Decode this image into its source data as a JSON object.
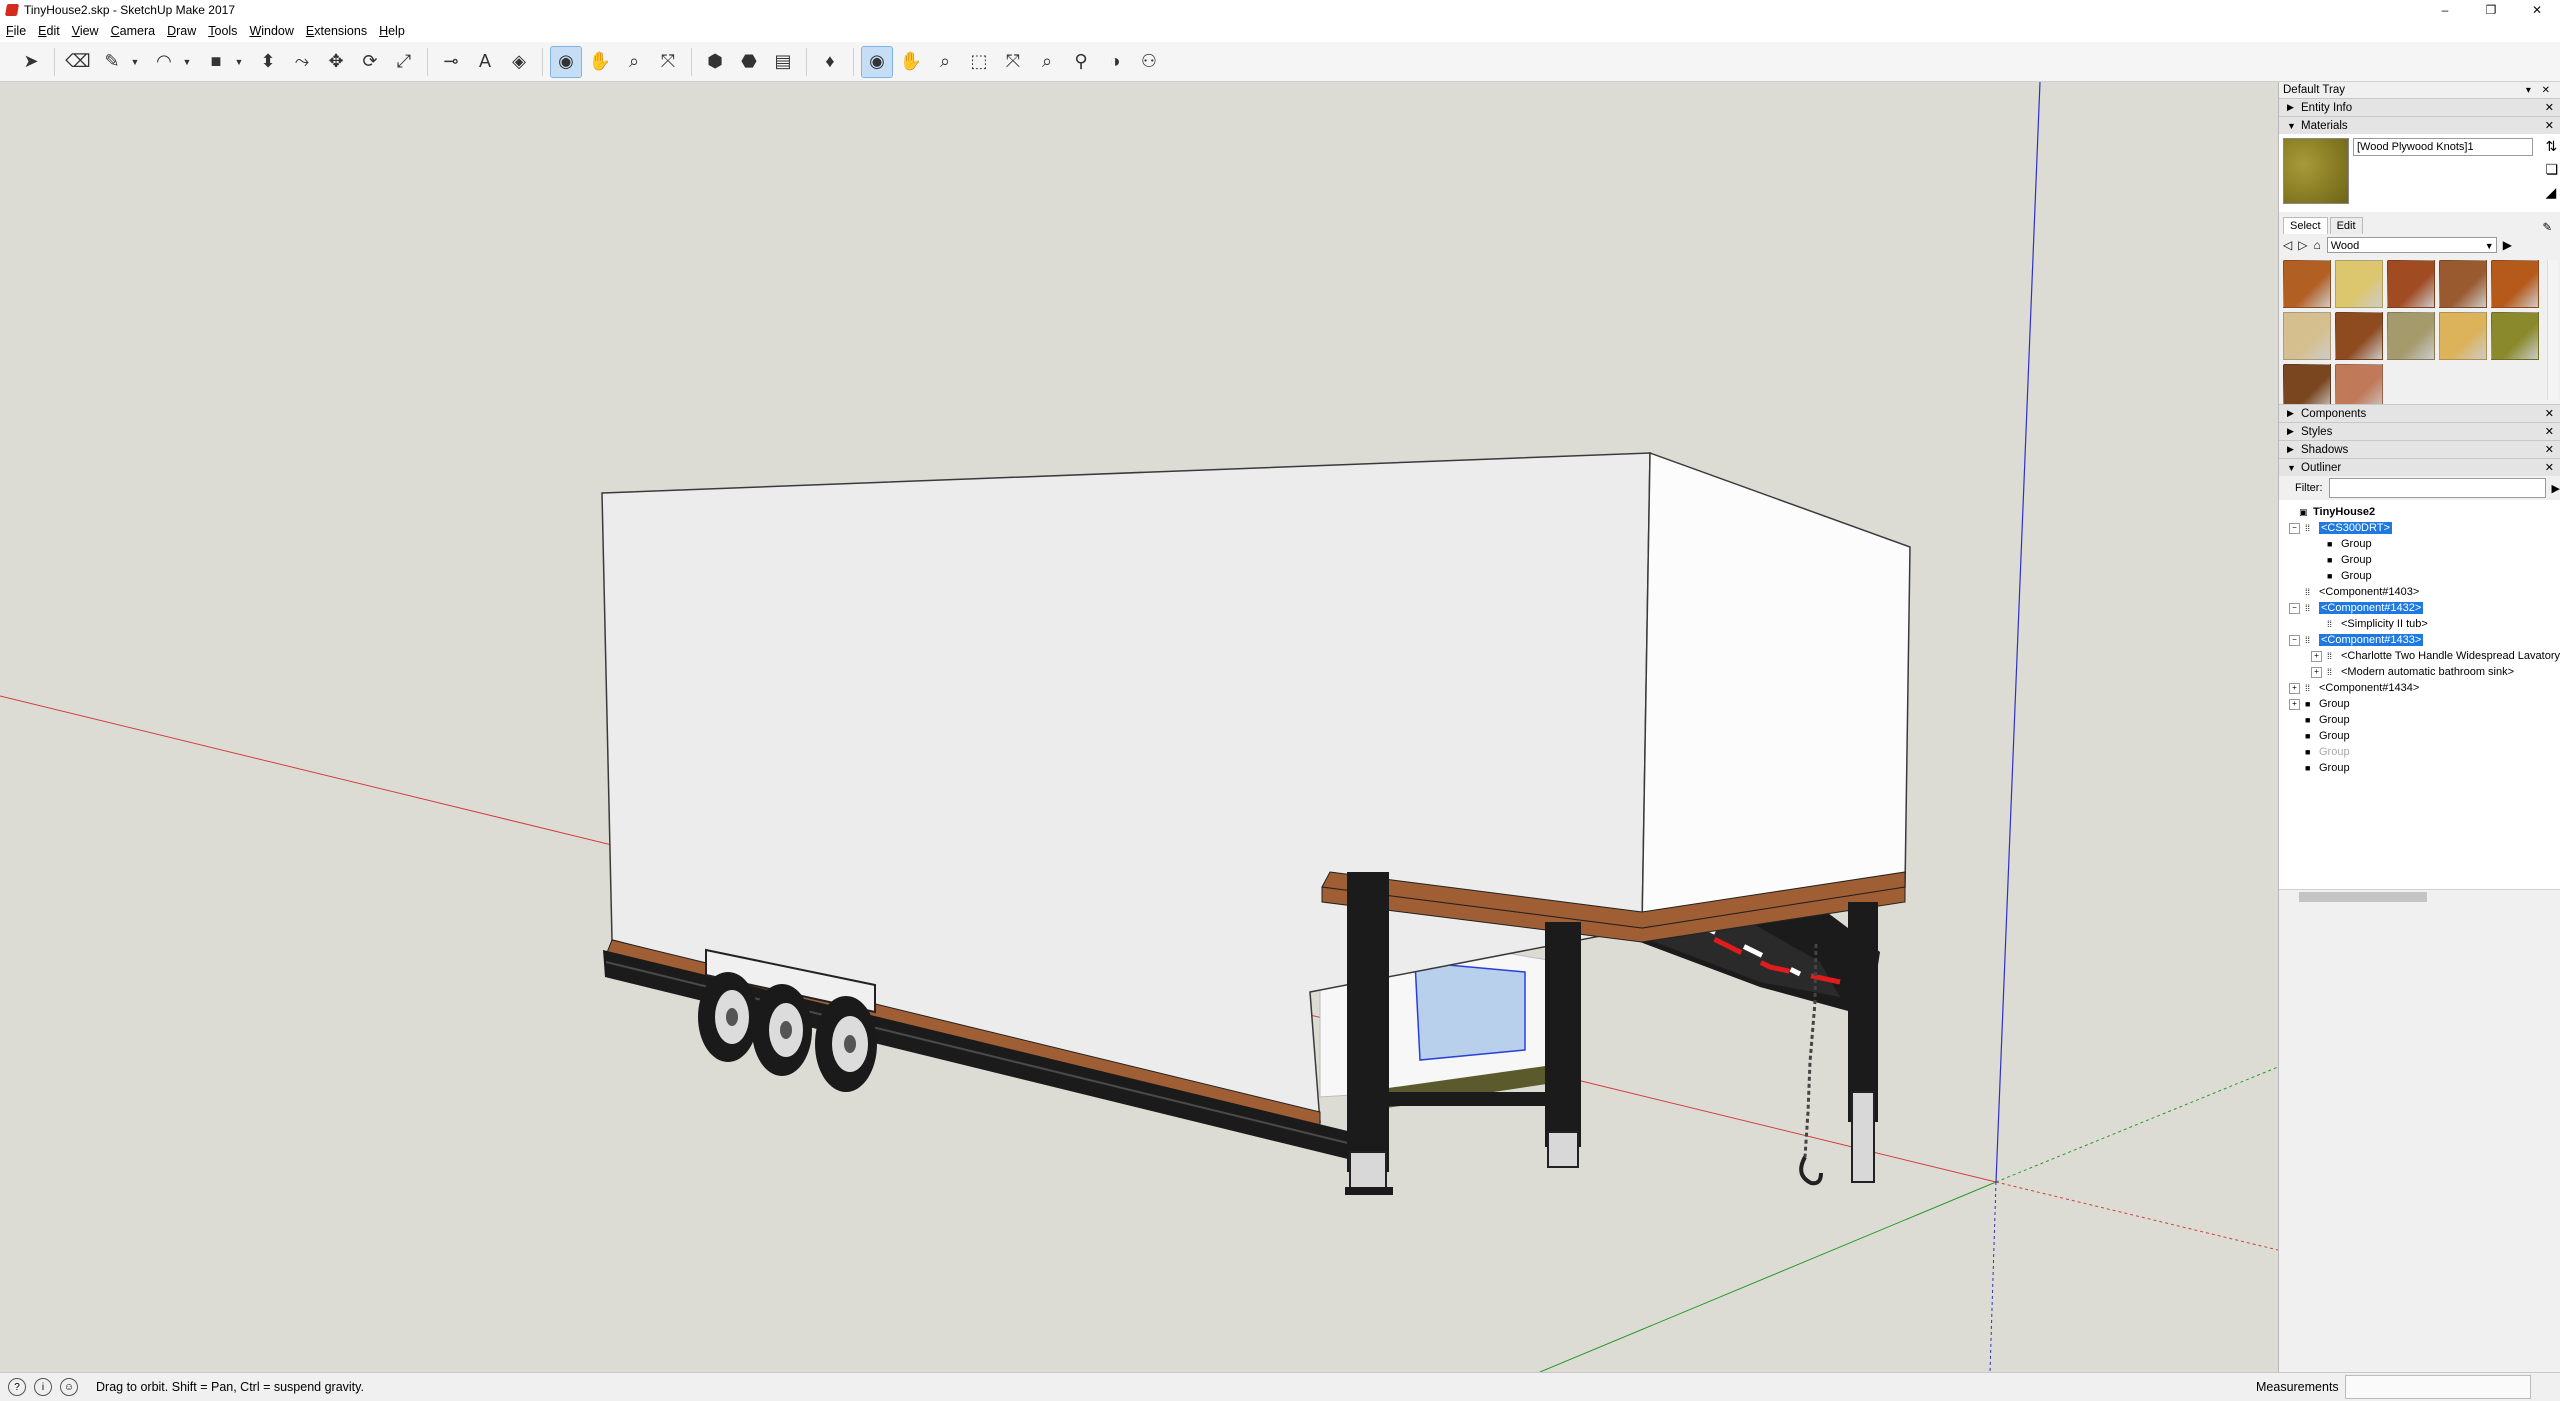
{
  "window": {
    "title": "TinyHouse2.skp - SketchUp Make 2017",
    "controls": [
      "–",
      "❐",
      "✕"
    ]
  },
  "menu": [
    "File",
    "Edit",
    "View",
    "Camera",
    "Draw",
    "Tools",
    "Window",
    "Extensions",
    "Help"
  ],
  "toolbar": {
    "tools": [
      {
        "name": "select-tool-icon",
        "glyph": "➤"
      },
      {
        "name": "eraser-tool-icon",
        "glyph": "⌫"
      },
      {
        "name": "line-tool-icon",
        "glyph": "✎"
      },
      {
        "name": "arc-tool-icon",
        "glyph": "◠"
      },
      {
        "name": "rectangle-tool-icon",
        "glyph": "■"
      },
      {
        "name": "push-pull-tool-icon",
        "glyph": "⬍"
      },
      {
        "name": "offset-tool-icon",
        "glyph": "⤳"
      },
      {
        "name": "move-tool-icon",
        "glyph": "✥"
      },
      {
        "name": "rotate-tool-icon",
        "glyph": "⟳"
      },
      {
        "name": "scale-tool-icon",
        "glyph": "⤢"
      },
      {
        "name": "tape-measure-tool-icon",
        "glyph": "⊸"
      },
      {
        "name": "text-tool-icon",
        "glyph": "A"
      },
      {
        "name": "paint-bucket-tool-icon",
        "glyph": "◈"
      },
      {
        "name": "orbit-tool-icon",
        "glyph": "◉"
      },
      {
        "name": "pan-tool-icon",
        "glyph": "✋"
      },
      {
        "name": "zoom-tool-icon",
        "glyph": "⌕"
      },
      {
        "name": "zoom-extents-tool-icon",
        "glyph": "⤧"
      },
      {
        "name": "warehouse-icon",
        "glyph": "⬢"
      },
      {
        "name": "extension-warehouse-icon",
        "glyph": "⬣"
      },
      {
        "name": "layout-icon",
        "glyph": "▤"
      },
      {
        "name": "ruby-icon",
        "glyph": "♦"
      },
      {
        "name": "orbit-active-icon",
        "glyph": "◉"
      },
      {
        "name": "pan-2-icon",
        "glyph": "✋"
      },
      {
        "name": "zoom-2-icon",
        "glyph": "⌕"
      },
      {
        "name": "zoom-window-icon",
        "glyph": "⬚"
      },
      {
        "name": "zoom-extents-2-icon",
        "glyph": "⤧"
      },
      {
        "name": "previous-view-icon",
        "glyph": "⌕"
      },
      {
        "name": "position-camera-icon",
        "glyph": "⚲"
      },
      {
        "name": "look-around-icon",
        "glyph": "◑"
      },
      {
        "name": "walk-icon",
        "glyph": "⚇"
      }
    ]
  },
  "tray": {
    "title": "Default Tray",
    "panels": {
      "entity_info": "Entity Info",
      "materials": "Materials",
      "components": "Components",
      "styles": "Styles",
      "shadows": "Shadows",
      "outliner": "Outliner"
    },
    "materials": {
      "current_name": "[Wood Plywood Knots]1",
      "tab_select": "Select",
      "tab_edit": "Edit",
      "collection": "Wood",
      "swatches": [
        "#b25f24",
        "#dcc66e",
        "#a04b22",
        "#9a5a30",
        "#b65a1c",
        "#d6bf8e",
        "#8e4b20",
        "#a49a6c",
        "#dcb25a",
        "#8a8a2c",
        "#7a4620",
        "#c07a5a"
      ]
    },
    "outliner": {
      "filter_label": "Filter:",
      "root": "TinyHouse2",
      "items": [
        {
          "label": "<CS300DRT>",
          "depth": 1,
          "selected": true,
          "expand": "minus",
          "type": "component"
        },
        {
          "label": "Group",
          "depth": 2,
          "selected": false,
          "expand": "",
          "type": "group"
        },
        {
          "label": "Group",
          "depth": 2,
          "selected": false,
          "expand": "",
          "type": "group"
        },
        {
          "label": "Group",
          "depth": 2,
          "selected": false,
          "expand": "",
          "type": "group"
        },
        {
          "label": "<Component#1403>",
          "depth": 1,
          "selected": false,
          "expand": "",
          "type": "component"
        },
        {
          "label": "<Component#1432>",
          "depth": 1,
          "selected": true,
          "expand": "minus",
          "type": "component"
        },
        {
          "label": "<Simplicity II tub>",
          "depth": 2,
          "selected": false,
          "expand": "",
          "type": "component"
        },
        {
          "label": "<Component#1433>",
          "depth": 1,
          "selected": true,
          "expand": "minus",
          "type": "component"
        },
        {
          "label": "<Charlotte Two Handle Widespread Lavatory",
          "depth": 2,
          "selected": false,
          "expand": "plus",
          "type": "component"
        },
        {
          "label": "<Modern automatic bathroom sink>",
          "depth": 2,
          "selected": false,
          "expand": "plus",
          "type": "component"
        },
        {
          "label": "<Component#1434>",
          "depth": 1,
          "selected": false,
          "expand": "plus",
          "type": "component"
        },
        {
          "label": "Group",
          "depth": 1,
          "selected": false,
          "expand": "plus",
          "type": "group"
        },
        {
          "label": "Group",
          "depth": 1,
          "selected": false,
          "expand": "",
          "type": "group"
        },
        {
          "label": "Group",
          "depth": 1,
          "selected": false,
          "expand": "",
          "type": "group"
        },
        {
          "label": "Group",
          "depth": 1,
          "selected": false,
          "expand": "",
          "type": "group",
          "dim": true
        },
        {
          "label": "Group",
          "depth": 1,
          "selected": false,
          "expand": "",
          "type": "group"
        }
      ]
    }
  },
  "status": {
    "hint": "Drag to orbit. Shift = Pan, Ctrl = suspend gravity.",
    "measurements_label": "Measurements"
  },
  "colors": {
    "viewport_bg": "#dcdcd5",
    "selection": "#1e7ae0",
    "axis_red": "#d04040",
    "axis_green": "#2a9a2a",
    "axis_blue": "#3030c8",
    "trailer_black": "#1b1b1b",
    "floor_wood": "#a05e34",
    "box_white": "#f4f4f4"
  }
}
